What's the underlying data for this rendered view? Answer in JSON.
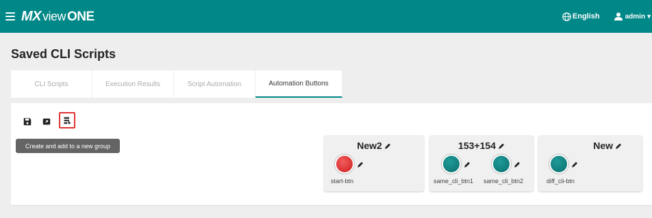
{
  "header": {
    "brand_mx": "MX",
    "brand_view": "view",
    "brand_one": "ONE",
    "language_label": "English",
    "user_label": "admin"
  },
  "page": {
    "title": "Saved CLI Scripts"
  },
  "tabs": [
    {
      "label": "CLI Scripts",
      "active": false
    },
    {
      "label": "Execution Results",
      "active": false
    },
    {
      "label": "Script Automation",
      "active": false
    },
    {
      "label": "Automation Buttons",
      "active": true
    }
  ],
  "toolbar": {
    "icons": [
      "save-icon",
      "import-icon",
      "add-group-icon"
    ],
    "tooltip": "Create and add to a new group"
  },
  "groups": [
    {
      "name": "New2",
      "buttons": [
        {
          "label": "start-btn",
          "color": "#d82b2b"
        }
      ]
    },
    {
      "name": "153+154",
      "buttons": [
        {
          "label": "same_cli_btn1",
          "color": "#0b7d7b"
        },
        {
          "label": "same_cli_btn2",
          "color": "#0b7d7b"
        }
      ]
    },
    {
      "name": "New",
      "buttons": [
        {
          "label": "diff_cli-btn",
          "color": "#0b7d7b"
        }
      ]
    }
  ],
  "colors": {
    "header": "#008787",
    "accent": "#008787",
    "stop": "#d82b2b"
  }
}
